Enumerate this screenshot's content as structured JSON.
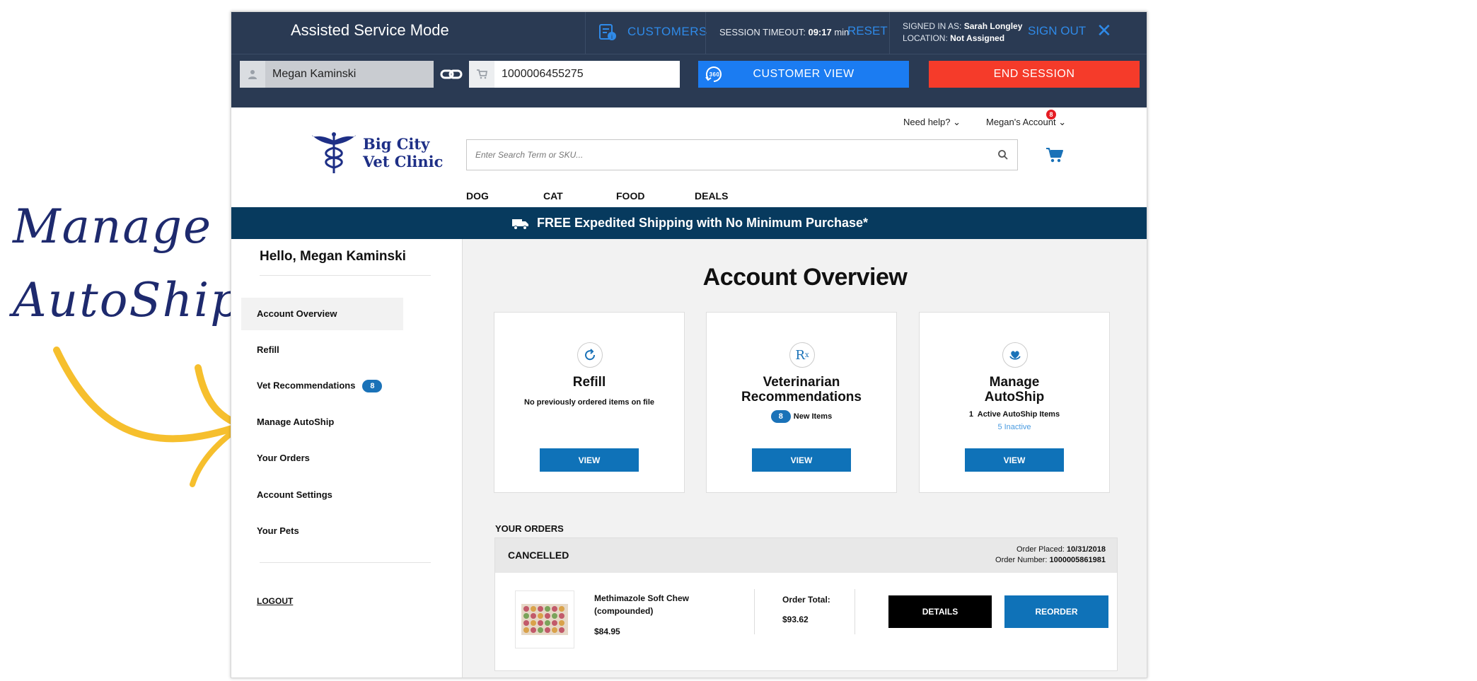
{
  "annotation": {
    "line1": "Manage",
    "line2": "AutoShip"
  },
  "asm": {
    "title": "Assisted Service Mode",
    "customers_label": "CUSTOMERS",
    "session_timeout_label": "SESSION TIMEOUT:",
    "session_timeout_value": "09:17",
    "session_timeout_unit": "min",
    "reset_label": "RESET",
    "signed_in_label": "SIGNED IN AS:",
    "signed_in_value": "Sarah Longley",
    "location_label": "LOCATION:",
    "location_value": "Not Assigned",
    "signout_label": "SIGN OUT",
    "customer_name": "Megan Kaminski",
    "cart_number": "1000006455275",
    "customer_view_label": "CUSTOMER VIEW",
    "end_session_label": "END SESSION",
    "accent": "#2f8ae8",
    "bar_color": "#2a3a53"
  },
  "header": {
    "need_help": "Need help?",
    "account_label": "Megan's Account",
    "account_badge": "8",
    "logo_line1": "Big City",
    "logo_line2": "Vet Clinic",
    "search_placeholder": "Enter Search Term or SKU...",
    "nav": [
      "DOG",
      "CAT",
      "FOOD",
      "DEALS"
    ]
  },
  "shipping_banner": "FREE Expedited Shipping with No Minimum Purchase*",
  "sidebar": {
    "greeting": "Hello, Megan Kaminski",
    "items": [
      {
        "label": "Account Overview"
      },
      {
        "label": "Refill"
      },
      {
        "label": "Vet Recommendations",
        "badge": "8"
      },
      {
        "label": "Manage AutoShip"
      },
      {
        "label": "Your Orders"
      },
      {
        "label": "Account Settings"
      },
      {
        "label": "Your Pets"
      }
    ],
    "logout": "LOGOUT"
  },
  "main": {
    "title": "Account Overview",
    "cards": [
      {
        "icon": "refresh-icon",
        "title": "Refill",
        "subtitle": "No previously ordered items on file",
        "button": "VIEW"
      },
      {
        "icon": "rx-icon",
        "title_line1": "Veterinarian",
        "title_line2": "Recommendations",
        "badge": "8",
        "subtitle": "New Items",
        "button": "VIEW"
      },
      {
        "icon": "heart-hand-icon",
        "title_line1": "Manage",
        "title_line2": "AutoShip",
        "active_count": "1",
        "subtitle": "Active AutoShip Items",
        "inactive": "5 Inactive",
        "button": "VIEW"
      }
    ],
    "orders_heading": "YOUR ORDERS",
    "order": {
      "status": "CANCELLED",
      "placed_label": "Order Placed:",
      "placed_value": "10/31/2018",
      "number_label": "Order Number:",
      "number_value": "1000005861981",
      "product_name": "Methimazole Soft Chew (compounded)",
      "product_price": "$84.95",
      "total_label": "Order Total:",
      "total_value": "$93.62",
      "details_label": "DETAILS",
      "reorder_label": "REORDER"
    }
  }
}
